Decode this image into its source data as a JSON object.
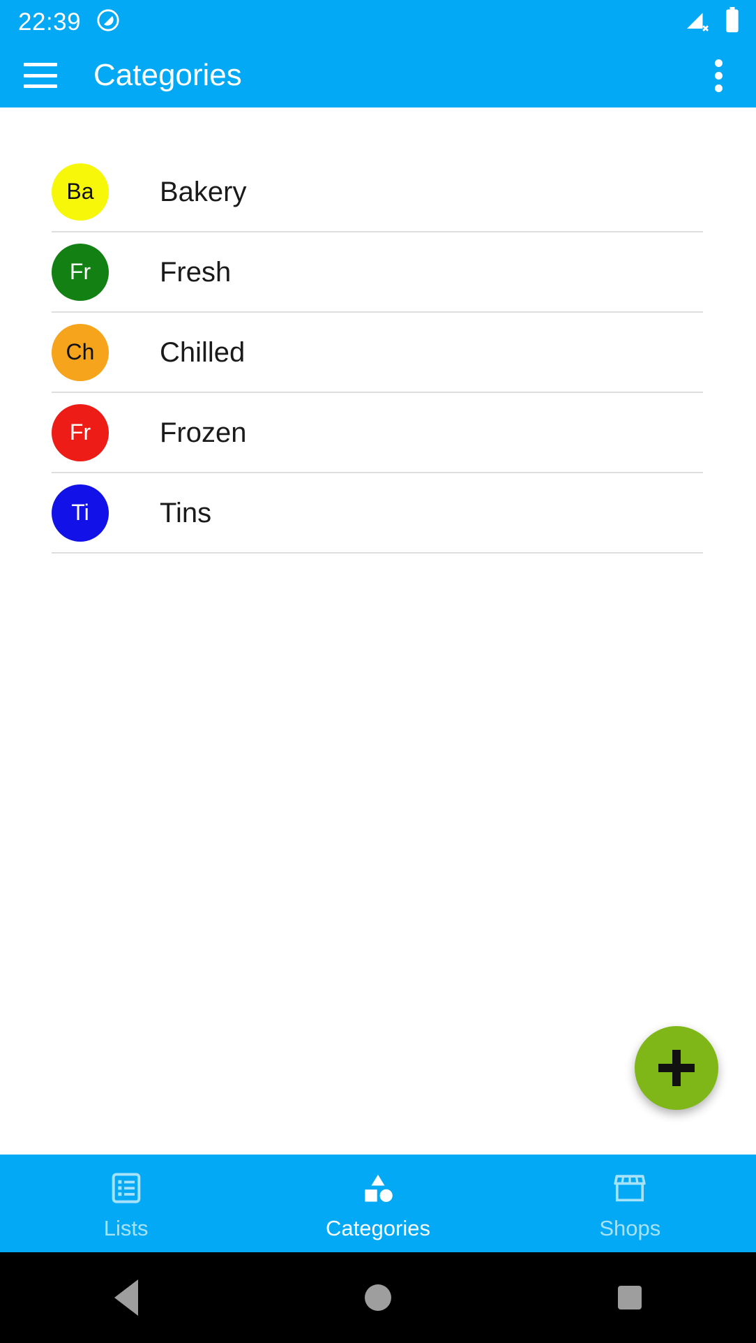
{
  "status_bar": {
    "time": "22:39",
    "icons": [
      "do-not-disturb-icon",
      "signal-off-icon",
      "battery-full-icon"
    ],
    "background": "#03A9F4"
  },
  "app_bar": {
    "menu_icon": "hamburger-menu-icon",
    "title": "Categories",
    "overflow_icon": "more-vert-icon",
    "background": "#03A9F4"
  },
  "categories": [
    {
      "initials": "Ba",
      "label": "Bakery",
      "color": "#F7F70A",
      "text_color": "#111111"
    },
    {
      "initials": "Fr",
      "label": "Fresh",
      "color": "#128012",
      "text_color": "#FFFFFF"
    },
    {
      "initials": "Ch",
      "label": "Chilled",
      "color": "#F5A41B",
      "text_color": "#111111"
    },
    {
      "initials": "Fr",
      "label": "Frozen",
      "color": "#ED1C16",
      "text_color": "#FFFFFF"
    },
    {
      "initials": "Ti",
      "label": "Tins",
      "color": "#1111E8",
      "text_color": "#FFFFFF"
    }
  ],
  "fab": {
    "icon": "plus-icon",
    "color": "#7FB718",
    "icon_color": "#111111"
  },
  "bottom_nav": {
    "tabs": [
      {
        "label": "Lists",
        "icon": "list-icon",
        "active": false
      },
      {
        "label": "Categories",
        "icon": "shapes-icon",
        "active": true
      },
      {
        "label": "Shops",
        "icon": "store-icon",
        "active": false
      }
    ],
    "background": "#03A9F4",
    "active_color": "#FFFFFF",
    "inactive_color": "#A6E2FA"
  },
  "system_nav": {
    "buttons": [
      "back-button",
      "home-button",
      "recents-button"
    ],
    "background": "#000000",
    "icon_color": "#9E9E9E"
  }
}
